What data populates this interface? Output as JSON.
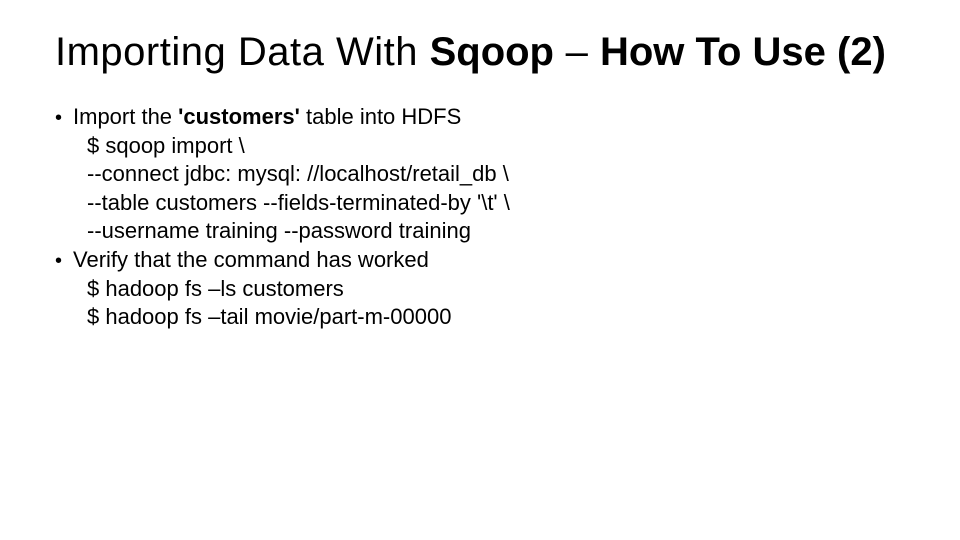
{
  "title": {
    "p1": "Importing Data With ",
    "p2": "Sqoop",
    "p3": " – ",
    "p4": "How To Use (2)"
  },
  "bullet1": {
    "pre": "Import the ",
    "bold": "'customers'",
    "post": " table into HDFS"
  },
  "code1": "$ sqoop import \\\n--connect jdbc: mysql: //localhost/retail_db \\\n--table customers --fields-terminated-by '\\t' \\\n--username training --password training",
  "bullet2": "Verify that the command has worked",
  "code2": "$ hadoop fs –ls customers\n$ hadoop fs –tail movie/part-m-00000"
}
